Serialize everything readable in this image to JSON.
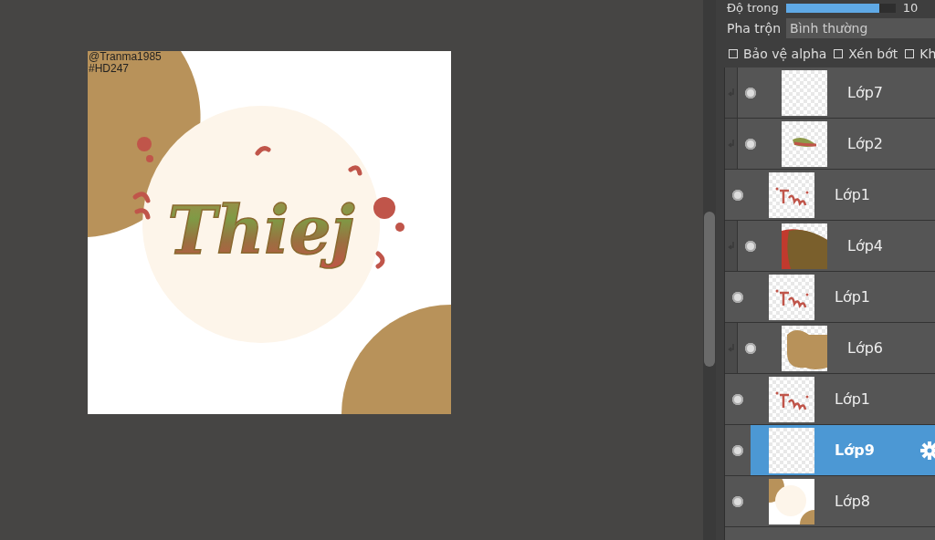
{
  "canvas": {
    "credit": [
      "@Tranma1985",
      "#HD247"
    ],
    "lettering": "Thiej"
  },
  "layer_panel": {
    "opacity": {
      "label": "Độ trong",
      "level": 0.85,
      "reading": "10"
    },
    "blend": {
      "label": "Pha trộn",
      "value": "Bình thường"
    },
    "options": [
      {
        "label": "Bảo vệ alpha",
        "checked": false
      },
      {
        "label": "Xén bớt",
        "checked": false
      },
      {
        "label": "Kh",
        "checked": false
      }
    ],
    "layers": [
      {
        "name": "Lớp7",
        "kind": "blank",
        "clipped": true,
        "selected": false
      },
      {
        "name": "Lớp2",
        "kind": "stroke",
        "clipped": true,
        "selected": false
      },
      {
        "name": "Lớp1",
        "kind": "lettering",
        "clipped": false,
        "selected": false
      },
      {
        "name": "Lớp4",
        "kind": "fill",
        "clipped": true,
        "selected": false
      },
      {
        "name": "Lớp1",
        "kind": "lettering",
        "clipped": false,
        "selected": false
      },
      {
        "name": "Lớp6",
        "kind": "blob",
        "clipped": true,
        "selected": false
      },
      {
        "name": "Lớp1",
        "kind": "lettering",
        "clipped": false,
        "selected": false
      },
      {
        "name": "Lớp9",
        "kind": "blank",
        "clipped": false,
        "selected": true
      },
      {
        "name": "Lớp8",
        "kind": "background",
        "clipped": false,
        "selected": false
      }
    ]
  }
}
